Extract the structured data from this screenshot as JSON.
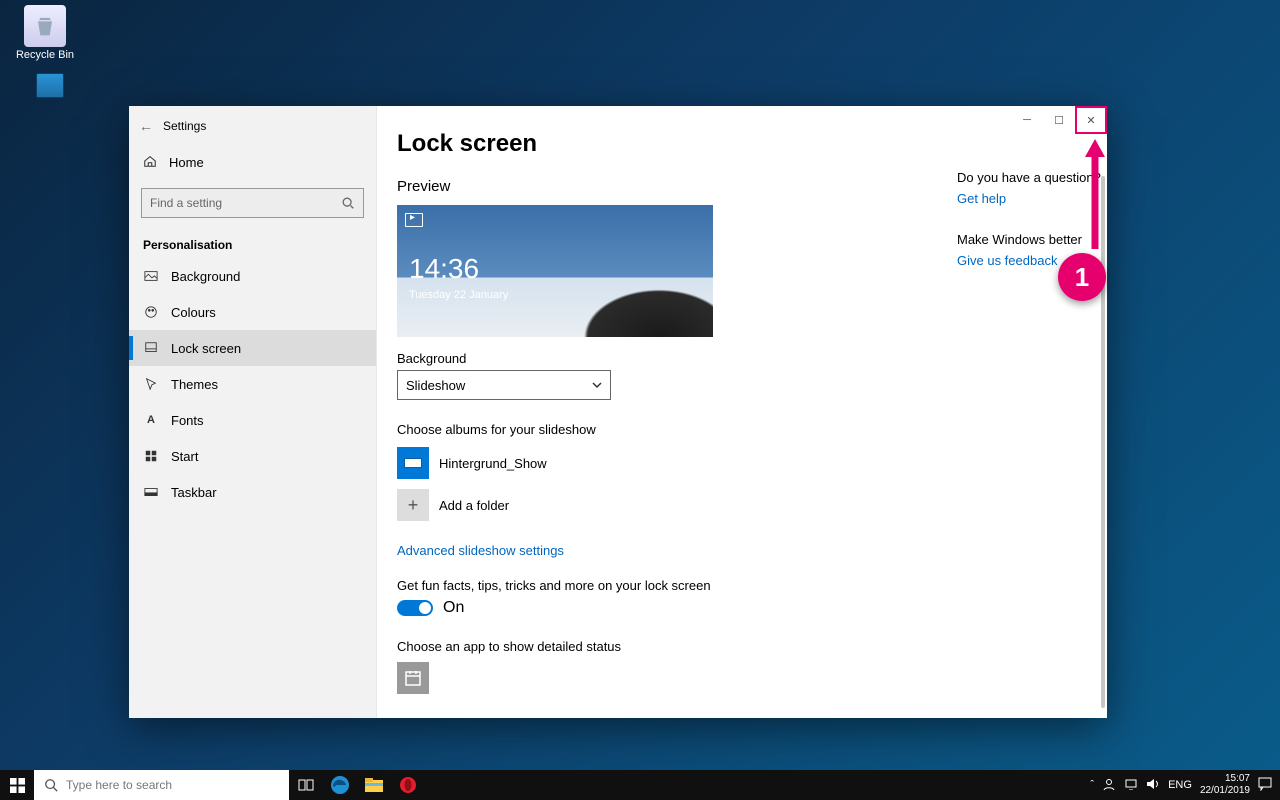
{
  "desktop": {
    "recycle": "Recycle Bin"
  },
  "window": {
    "title": "Settings",
    "home": "Home",
    "search_placeholder": "Find a setting",
    "category": "Personalisation",
    "nav": [
      {
        "label": "Background"
      },
      {
        "label": "Colours"
      },
      {
        "label": "Lock screen"
      },
      {
        "label": "Themes"
      },
      {
        "label": "Fonts"
      },
      {
        "label": "Start"
      },
      {
        "label": "Taskbar"
      }
    ]
  },
  "page": {
    "heading": "Lock screen",
    "preview_label": "Preview",
    "preview_time": "14:36",
    "preview_date": "Tuesday 22 January",
    "background_label": "Background",
    "background_value": "Slideshow",
    "albums_label": "Choose albums for your slideshow",
    "album_name": "Hintergrund_Show",
    "add_folder": "Add a folder",
    "adv_link": "Advanced slideshow settings",
    "fun_label": "Get fun facts, tips, tricks and more on your lock screen",
    "toggle_state": "On",
    "detailed_label": "Choose an app to show detailed status"
  },
  "aside": {
    "q1": "Do you have a question?",
    "l1": "Get help",
    "q2": "Make Windows better",
    "l2": "Give us feedback"
  },
  "annotation": {
    "num": "1"
  },
  "taskbar": {
    "search_placeholder": "Type here to search",
    "lang": "ENG",
    "time": "15:07",
    "date": "22/01/2019"
  }
}
